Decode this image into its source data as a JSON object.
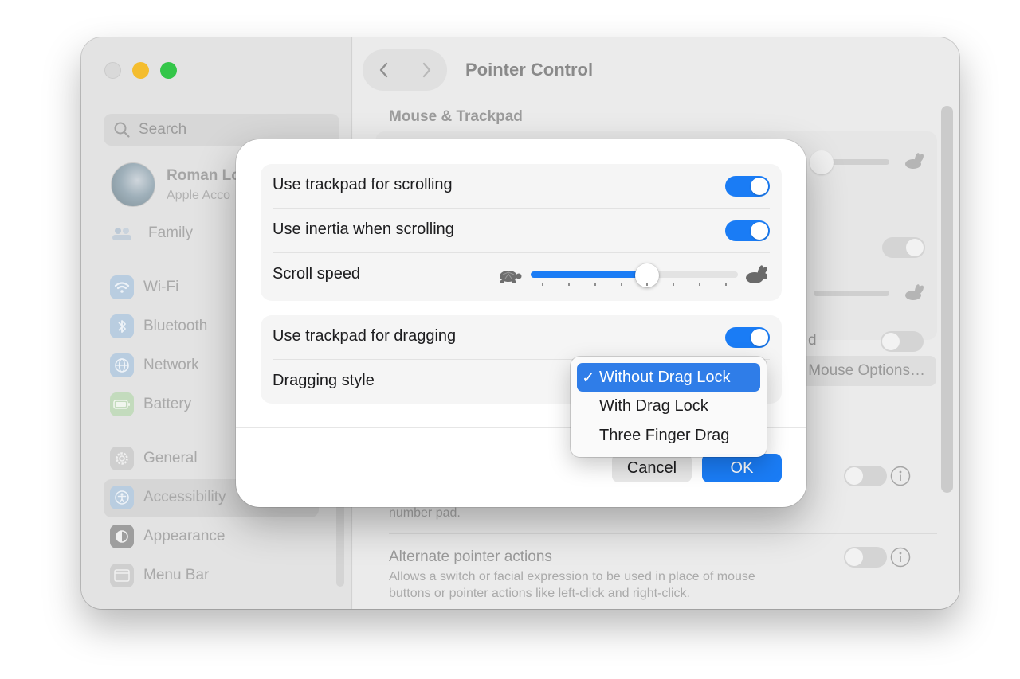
{
  "window": {
    "title": "Pointer Control",
    "section_title": "Mouse & Trackpad"
  },
  "sidebar": {
    "search_placeholder": "Search",
    "user_name": "Roman Lo",
    "user_subtitle": "Apple Acco",
    "family_label": "Family",
    "items": [
      {
        "label": "Wi-Fi",
        "icon": "wifi-icon"
      },
      {
        "label": "Bluetooth",
        "icon": "bluetooth-icon"
      },
      {
        "label": "Network",
        "icon": "globe-icon"
      },
      {
        "label": "Battery",
        "icon": "battery-icon"
      },
      {
        "label": "General",
        "icon": "gear-icon"
      },
      {
        "label": "Accessibility",
        "icon": "accessibility-icon"
      },
      {
        "label": "Appearance",
        "icon": "appearance-icon"
      },
      {
        "label": "Menu Bar",
        "icon": "menubar-icon"
      }
    ],
    "selected_item": "Accessibility"
  },
  "background": {
    "mouse_options_label": "Mouse Options…",
    "partial_label": "d",
    "number_pad_text": "number pad.",
    "alternate_title": "Alternate pointer actions",
    "alternate_desc_line1": "Allows a switch or facial expression to be used in place of mouse",
    "alternate_desc_line2": "buttons or pointer actions like left-click and right-click."
  },
  "dialog": {
    "group1": [
      {
        "label": "Use trackpad for scrolling",
        "toggle_on": true
      },
      {
        "label": "Use inertia when scrolling",
        "toggle_on": true
      }
    ],
    "scroll_speed": {
      "label": "Scroll speed",
      "value": 0.56,
      "ticks": 8
    },
    "dragging_toggle": {
      "label": "Use trackpad for dragging",
      "toggle_on": true
    },
    "dragging_style": {
      "label": "Dragging style",
      "options": [
        "Without Drag Lock",
        "With Drag Lock",
        "Three Finger Drag"
      ],
      "selected": "Without Drag Lock"
    },
    "cancel_label": "Cancel",
    "ok_label": "OK"
  },
  "colors": {
    "accent": "#1a7cf5",
    "menu_highlight": "#2f7de8",
    "traffic_min": "#f4bd2f",
    "traffic_max": "#34c649"
  }
}
